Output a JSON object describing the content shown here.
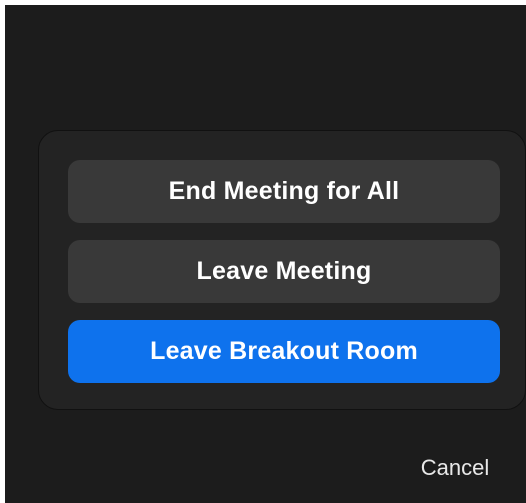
{
  "dialog": {
    "buttons": {
      "end_meeting_label": "End Meeting for All",
      "leave_meeting_label": "Leave Meeting",
      "leave_breakout_label": "Leave Breakout Room"
    }
  },
  "cancel_label": "Cancel",
  "colors": {
    "background": "#1c1c1c",
    "dialog_background": "#232323",
    "secondary_button": "#393939",
    "primary_button": "#0e72ed",
    "text": "#ffffff"
  }
}
